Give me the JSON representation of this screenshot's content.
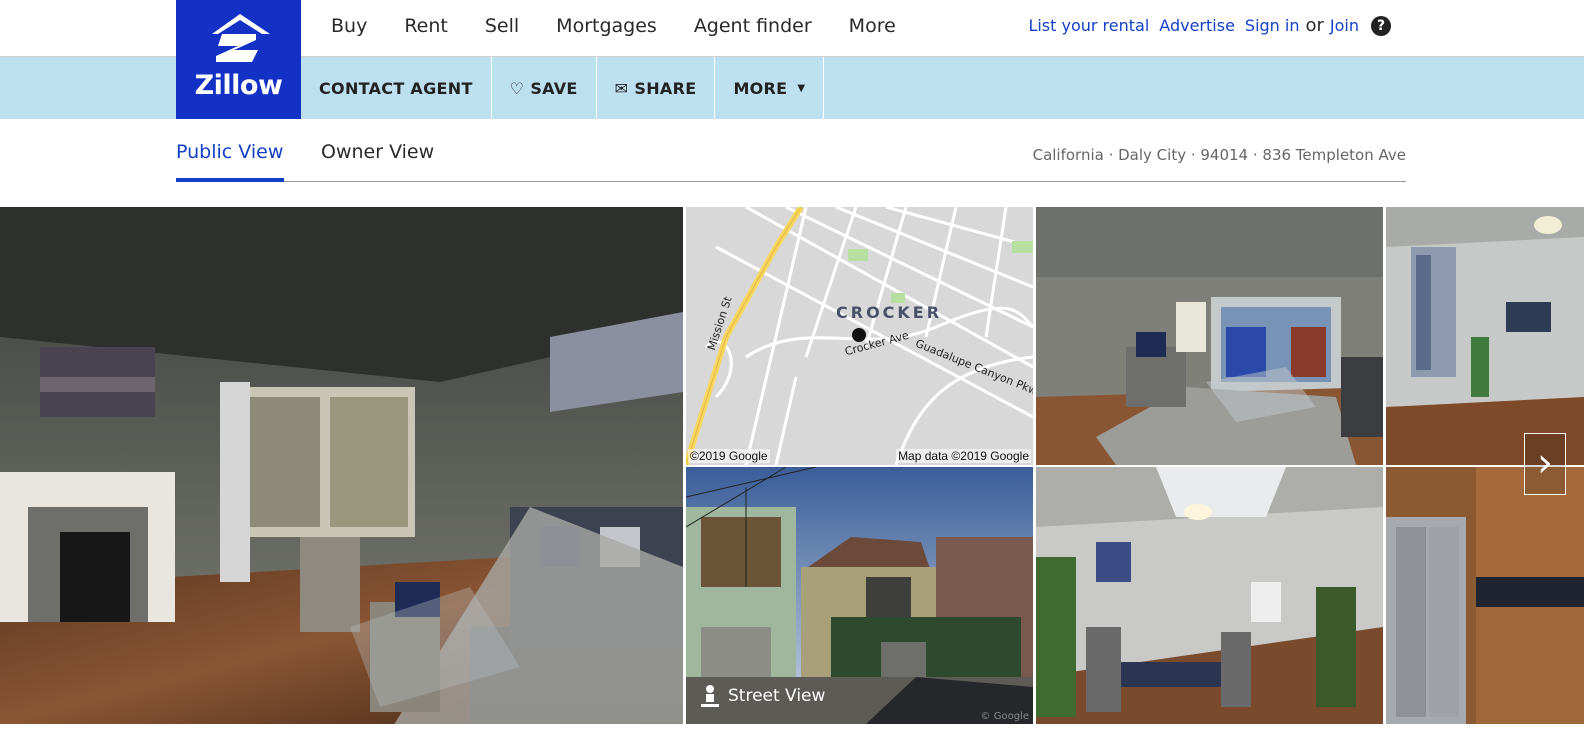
{
  "brand": {
    "name": "Zillow",
    "color": "#1332c5"
  },
  "nav": {
    "main": [
      "Buy",
      "Rent",
      "Sell",
      "Mortgages",
      "Agent finder",
      "More"
    ],
    "list_rental": "List your rental",
    "advertise": "Advertise",
    "sign_in": "Sign in",
    "or": "or",
    "join": "Join",
    "help": "?"
  },
  "actions": {
    "contact": "CONTACT AGENT",
    "save": "SAVE",
    "share": "SHARE",
    "more": "MORE"
  },
  "view_tabs": {
    "public": "Public View",
    "owner": "Owner View",
    "active": "public"
  },
  "breadcrumb": "California · Daly City · 94014 · 836 Templeton Ave",
  "gallery": {
    "map": {
      "neighborhood": "CROCKER",
      "street_1": "Crocker Ave",
      "street_2": "Guadalupe Canyon Pkwy",
      "street_3": "Mission St",
      "copyright_left": "©2019 Google",
      "copyright_right": "Map data ©2019 Google"
    },
    "street_view_label": "Street View",
    "street_view_credit": "© Google"
  },
  "colors": {
    "link": "#1440c8",
    "action_bar": "#bde0f1",
    "map_bg": "#d6d6d6"
  }
}
